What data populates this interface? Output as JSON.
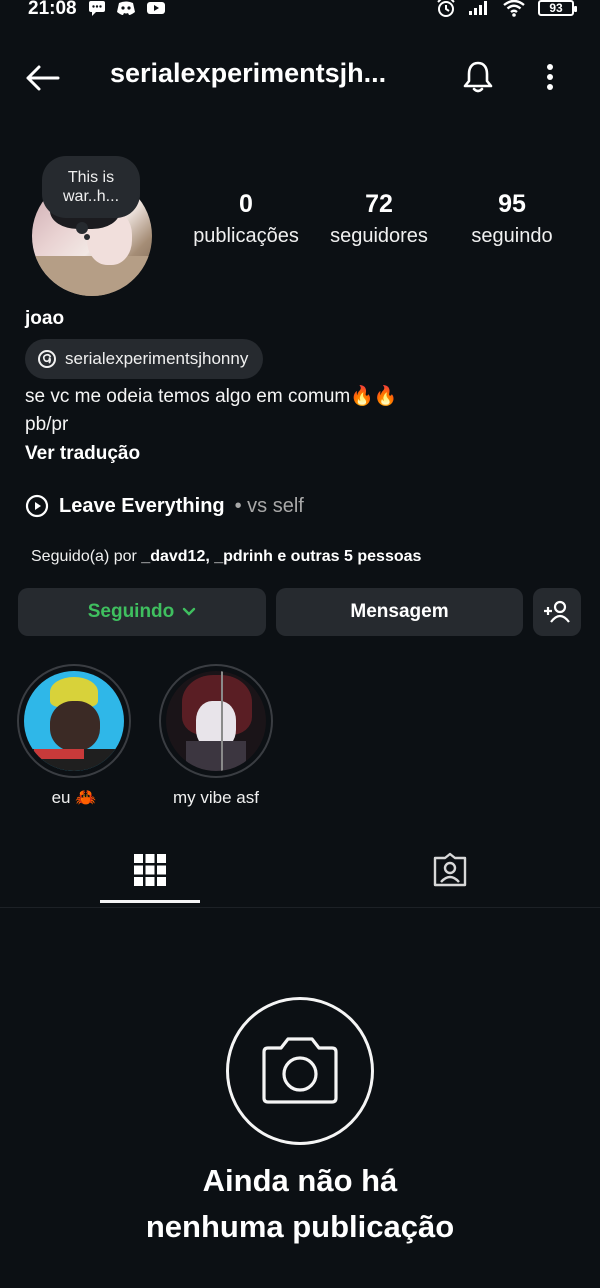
{
  "status_bar": {
    "time": "21:08",
    "battery": "93"
  },
  "header": {
    "username": "serialexperimentsjh..."
  },
  "profile": {
    "note": "This is war..h...",
    "stats": [
      {
        "value": "0",
        "label": "publicações"
      },
      {
        "value": "72",
        "label": "seguidores"
      },
      {
        "value": "95",
        "label": "seguindo"
      }
    ],
    "name": "joao",
    "threads_handle": "serialexperimentsjhonny",
    "bio_line1": "se vc me odeia temos algo em comum🔥🔥",
    "bio_line2": "pb/pr",
    "translate_label": "Ver tradução",
    "music": {
      "title": "Leave Everything",
      "artist": "• vs self"
    },
    "followed_by": {
      "prefix": "Seguido(a) por ",
      "users": "_davd12, _pdrinh",
      "suffix": " e outras 5 pessoas"
    }
  },
  "actions": {
    "following_label": "Seguindo",
    "message_label": "Mensagem"
  },
  "highlights": [
    {
      "label": "eu 🦀"
    },
    {
      "label": "my vibe asf"
    }
  ],
  "empty_state": {
    "line1": "Ainda não há",
    "line2": "nenhuma publicação"
  },
  "colors": {
    "background": "#0c1014",
    "surface": "#262a2f",
    "following_green": "#3fbf5f"
  }
}
